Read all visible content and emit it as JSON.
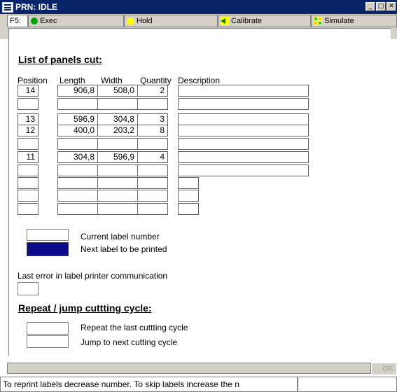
{
  "window": {
    "title": "PRN: IDLE"
  },
  "toolbar": {
    "fkey": "F5:",
    "buttons": [
      {
        "label": "Exec",
        "accent": "#00a000"
      },
      {
        "label": "Hold",
        "accent": "#ffff00"
      },
      {
        "label": "Calibrate",
        "accent": "#008000"
      },
      {
        "label": "Simulate",
        "accent": "#33cc33"
      }
    ]
  },
  "panels": {
    "heading": "List of panels cut:",
    "columns": [
      "Position",
      "Length",
      "Width",
      "Quantity",
      "Description"
    ],
    "rows": [
      {
        "position": "14",
        "length": "906,8",
        "width": "508,0",
        "quantity": "2",
        "description": ""
      },
      {
        "position": "",
        "length": "",
        "width": "",
        "quantity": "",
        "description": ""
      },
      {
        "position": "13",
        "length": "596,9",
        "width": "304,8",
        "quantity": "3",
        "description": ""
      },
      {
        "position": "12",
        "length": "400,0",
        "width": "203,2",
        "quantity": "8",
        "description": ""
      },
      {
        "position": "",
        "length": "",
        "width": "",
        "quantity": "",
        "description": ""
      },
      {
        "position": "11",
        "length": "304,8",
        "width": "596,9",
        "quantity": "4",
        "description": ""
      },
      {
        "position": "",
        "length": "",
        "width": "",
        "quantity": "",
        "description": ""
      },
      {
        "position": "",
        "length": "",
        "width": "",
        "quantity": "",
        "description": ""
      },
      {
        "position": "",
        "length": "",
        "width": "",
        "quantity": "",
        "description": ""
      },
      {
        "position": "",
        "length": "",
        "width": "",
        "quantity": "",
        "description": ""
      }
    ]
  },
  "labels": {
    "current": "Current label number",
    "next": "Next label to be printed",
    "next_color": "#0a0a8a"
  },
  "error": {
    "label": "Last error in label printer communication"
  },
  "cycle": {
    "heading": "Repeat / jump cuttting cycle:",
    "repeat": "Repeat the last cuttting cycle",
    "jump": "Jump to next cutting cycle"
  },
  "footer": {
    "ok": "OK",
    "status": "To reprint labels decrease number. To skip labels increase the n"
  }
}
